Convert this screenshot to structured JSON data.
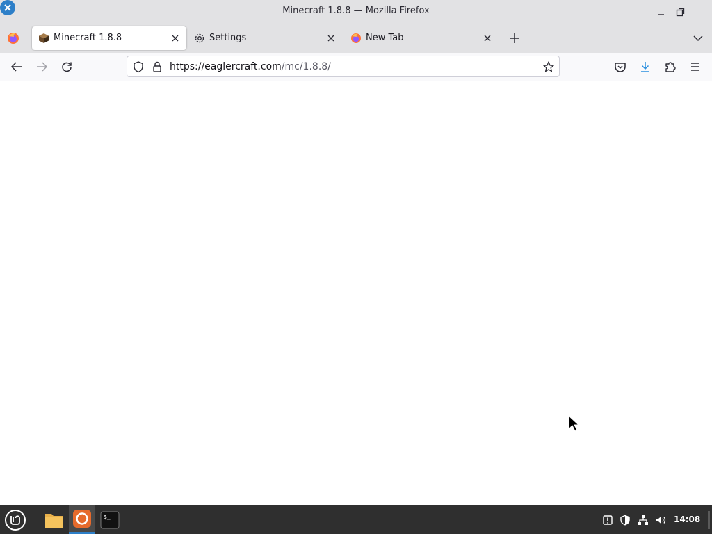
{
  "window": {
    "title": "Minecraft 1.8.8 — Mozilla Firefox"
  },
  "tabs": [
    {
      "label": "Minecraft 1.8.8",
      "icon": "minecraft-block-icon",
      "active": true
    },
    {
      "label": "Settings",
      "icon": "gear-icon",
      "active": false
    },
    {
      "label": "New Tab",
      "icon": "firefox-icon",
      "active": false
    }
  ],
  "navbar": {
    "url_host": "https://eaglercraft.com",
    "url_path": "/mc/1.8.8/"
  },
  "taskbar": {
    "clock": "14:08",
    "apps": [
      "files",
      "firefox",
      "terminal"
    ]
  },
  "colors": {
    "chrome": "#e2e2e4",
    "navbar": "#f9f9fb",
    "taskbar": "#2f2f2f",
    "accent": "#2d7fc8",
    "download_arrow": "#2a8fdf"
  }
}
